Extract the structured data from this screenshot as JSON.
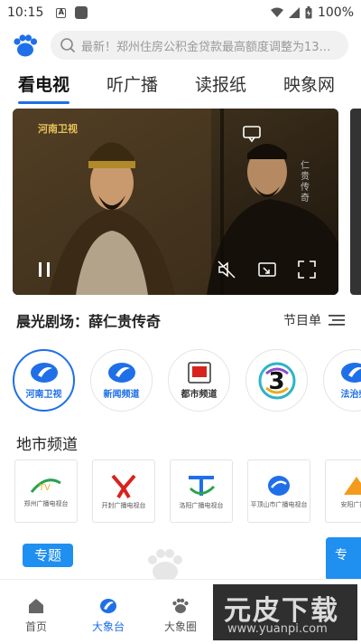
{
  "status_bar": {
    "time": "10:15",
    "battery": "100%"
  },
  "header": {
    "search_placeholder": "最新！郑州住房公积金贷款最高额度调整为13…"
  },
  "tabs": [
    {
      "label": "看电视",
      "active": true
    },
    {
      "label": "听广播",
      "active": false
    },
    {
      "label": "读报纸",
      "active": false
    },
    {
      "label": "映象网",
      "active": false
    }
  ],
  "player": {
    "channel_logo": "河南卫视",
    "subtitle": "仁贵传奇"
  },
  "now_playing": {
    "title": "晨光剧场：薛仁贵传奇",
    "schedule_label": "节目单"
  },
  "channels": [
    {
      "label": "河南卫视",
      "color": "#1f6fe8",
      "active": true
    },
    {
      "label": "新闻频道",
      "color": "#1f6fe8",
      "active": false
    },
    {
      "label": "都市频道",
      "color": "#333333",
      "active": false
    },
    {
      "label": "3",
      "color": "#2fb3c8",
      "active": false
    },
    {
      "label": "法治频",
      "color": "#1f6fe8",
      "active": false
    }
  ],
  "local_section": {
    "title": "地市频道"
  },
  "locals": [
    {
      "label": "郑州广播电视台"
    },
    {
      "label": "开封广播电视台"
    },
    {
      "label": "洛阳广播电视台"
    },
    {
      "label": "平顶山市广播电视台"
    },
    {
      "label": "安阳广播电"
    }
  ],
  "topics": {
    "badge": "专题",
    "thumb_label": "专"
  },
  "bottom_nav": [
    {
      "label": "首页",
      "active": false
    },
    {
      "label": "大象台",
      "active": true
    },
    {
      "label": "大象圈",
      "active": false
    },
    {
      "label": "",
      "active": false
    },
    {
      "label": "",
      "active": false
    }
  ],
  "watermark": {
    "big": "元皮下载",
    "small": "www.yuanpi.com"
  },
  "colors": {
    "accent": "#1f6fe8",
    "badge": "#1f8ff0"
  }
}
